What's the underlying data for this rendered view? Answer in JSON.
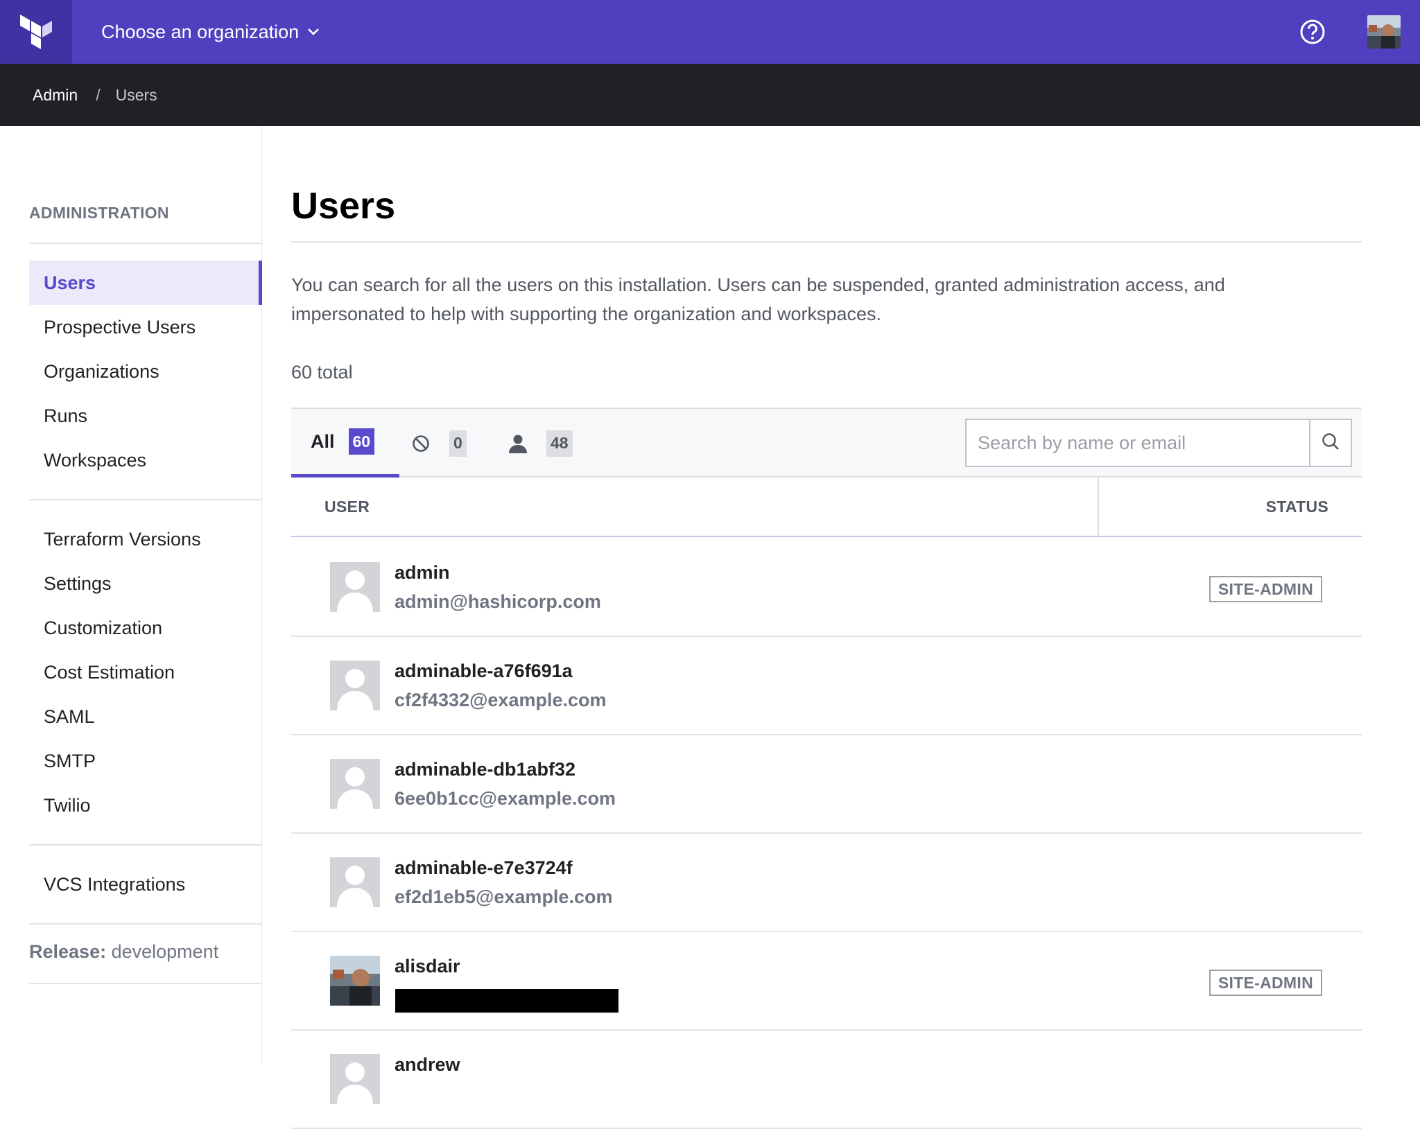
{
  "topbar": {
    "org_switcher_label": "Choose an organization"
  },
  "breadcrumb": {
    "items": [
      "Admin",
      "Users"
    ],
    "separator": "/"
  },
  "sidebar": {
    "heading": "ADMINISTRATION",
    "groups": [
      [
        "Users",
        "Prospective Users",
        "Organizations",
        "Runs",
        "Workspaces"
      ],
      [
        "Terraform Versions",
        "Settings",
        "Customization",
        "Cost Estimation",
        "SAML",
        "SMTP",
        "Twilio"
      ],
      [
        "VCS Integrations"
      ]
    ],
    "active_item": "Users",
    "release_label": "Release:",
    "release_value": "development"
  },
  "main": {
    "title": "Users",
    "description": "You can search for all the users on this installation. Users can be suspended, granted administration access, and impersonated to help with supporting the organization and workspaces.",
    "total": "60 total",
    "filters": {
      "all_label": "All",
      "all_count": "60",
      "suspended_count": "0",
      "active_count": "48"
    },
    "search": {
      "placeholder": "Search by name or email",
      "value": ""
    },
    "table": {
      "columns": [
        "USER",
        "STATUS"
      ],
      "rows": [
        {
          "name": "admin",
          "email": "admin@hashicorp.com",
          "status": "SITE-ADMIN",
          "photo": false,
          "email_redacted": false
        },
        {
          "name": "adminable-a76f691a",
          "email": "cf2f4332@example.com",
          "status": "",
          "photo": false,
          "email_redacted": false
        },
        {
          "name": "adminable-db1abf32",
          "email": "6ee0b1cc@example.com",
          "status": "",
          "photo": false,
          "email_redacted": false
        },
        {
          "name": "adminable-e7e3724f",
          "email": "ef2d1eb5@example.com",
          "status": "",
          "photo": false,
          "email_redacted": false
        },
        {
          "name": "alisdair",
          "email": "",
          "status": "SITE-ADMIN",
          "photo": true,
          "email_redacted": true
        },
        {
          "name": "andrew",
          "email": "",
          "status": "",
          "photo": false,
          "email_redacted": false
        }
      ]
    }
  },
  "colors": {
    "brand": "#5040bf",
    "brand_dark": "#3f33a4",
    "accent": "#5849cd",
    "breadcrumb_bg": "#1f2124"
  },
  "icons": {
    "logo": "terraform-logo-icon",
    "org_chevron": "chevron-down-icon",
    "help": "help-circle-icon",
    "suspended_filter": "ban-icon",
    "active_filter": "user-icon",
    "search": "search-icon",
    "default_avatar": "default-avatar-icon"
  }
}
